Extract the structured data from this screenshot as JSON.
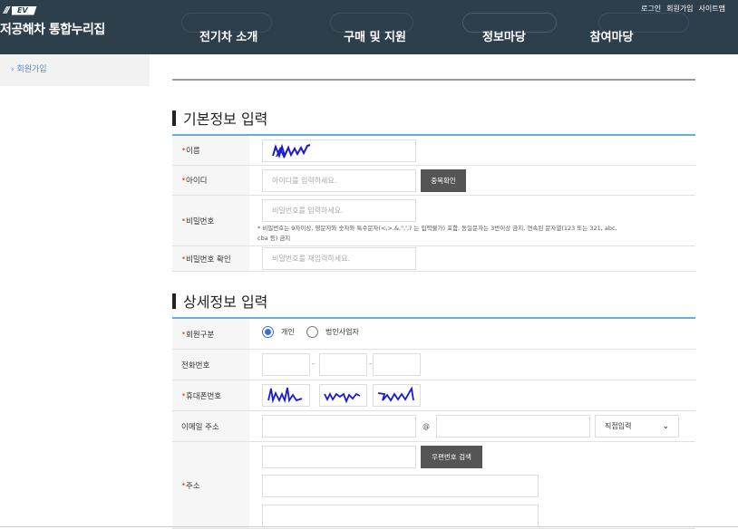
{
  "header": {
    "logo_mark": "EV",
    "logo_text": "저공해차 통합누리집",
    "util_links": [
      "로그인",
      "회원가입",
      "사이트맵"
    ],
    "nav": [
      "전기차 소개",
      "구매 및 지원",
      "정보마당",
      "참여마당"
    ]
  },
  "sidebar": {
    "items": [
      {
        "label": "› 회원가입"
      }
    ]
  },
  "basic": {
    "title": "기본정보 입력",
    "name_label": "이름",
    "id_label": "아이디",
    "id_placeholder": "아이디를 입력하세요.",
    "dup_check": "중복확인",
    "pw_label": "비밀번호",
    "pw_placeholder": "비밀번호를 입력하세요.",
    "pw_note": "* 비밀번호는 9자이상, 영문자와 숫자와 특수문자(<,>,&,\",',? 는 입력불가) 포함, 동일문자는 3번이상 금지, 연속된 문자열(123 또는 321, abc, cba 등) 금지",
    "pw_confirm_label": "비밀번호 확인",
    "pw_confirm_placeholder": "비밀번호를 재입력하세요."
  },
  "detail": {
    "title": "상세정보 입력",
    "member_type_label": "회원구분",
    "member_types": [
      "개인",
      "법인사업자"
    ],
    "phone_label": "전화번호",
    "dash": "-",
    "mobile_label": "휴대폰번호",
    "email_label": "이메일 주소",
    "at": "@",
    "email_select": "직접입력",
    "address_label": "주소",
    "postcode_btn": "우편번호 검색"
  },
  "required_mark": "•",
  "ink_color": "#1a1ad6"
}
